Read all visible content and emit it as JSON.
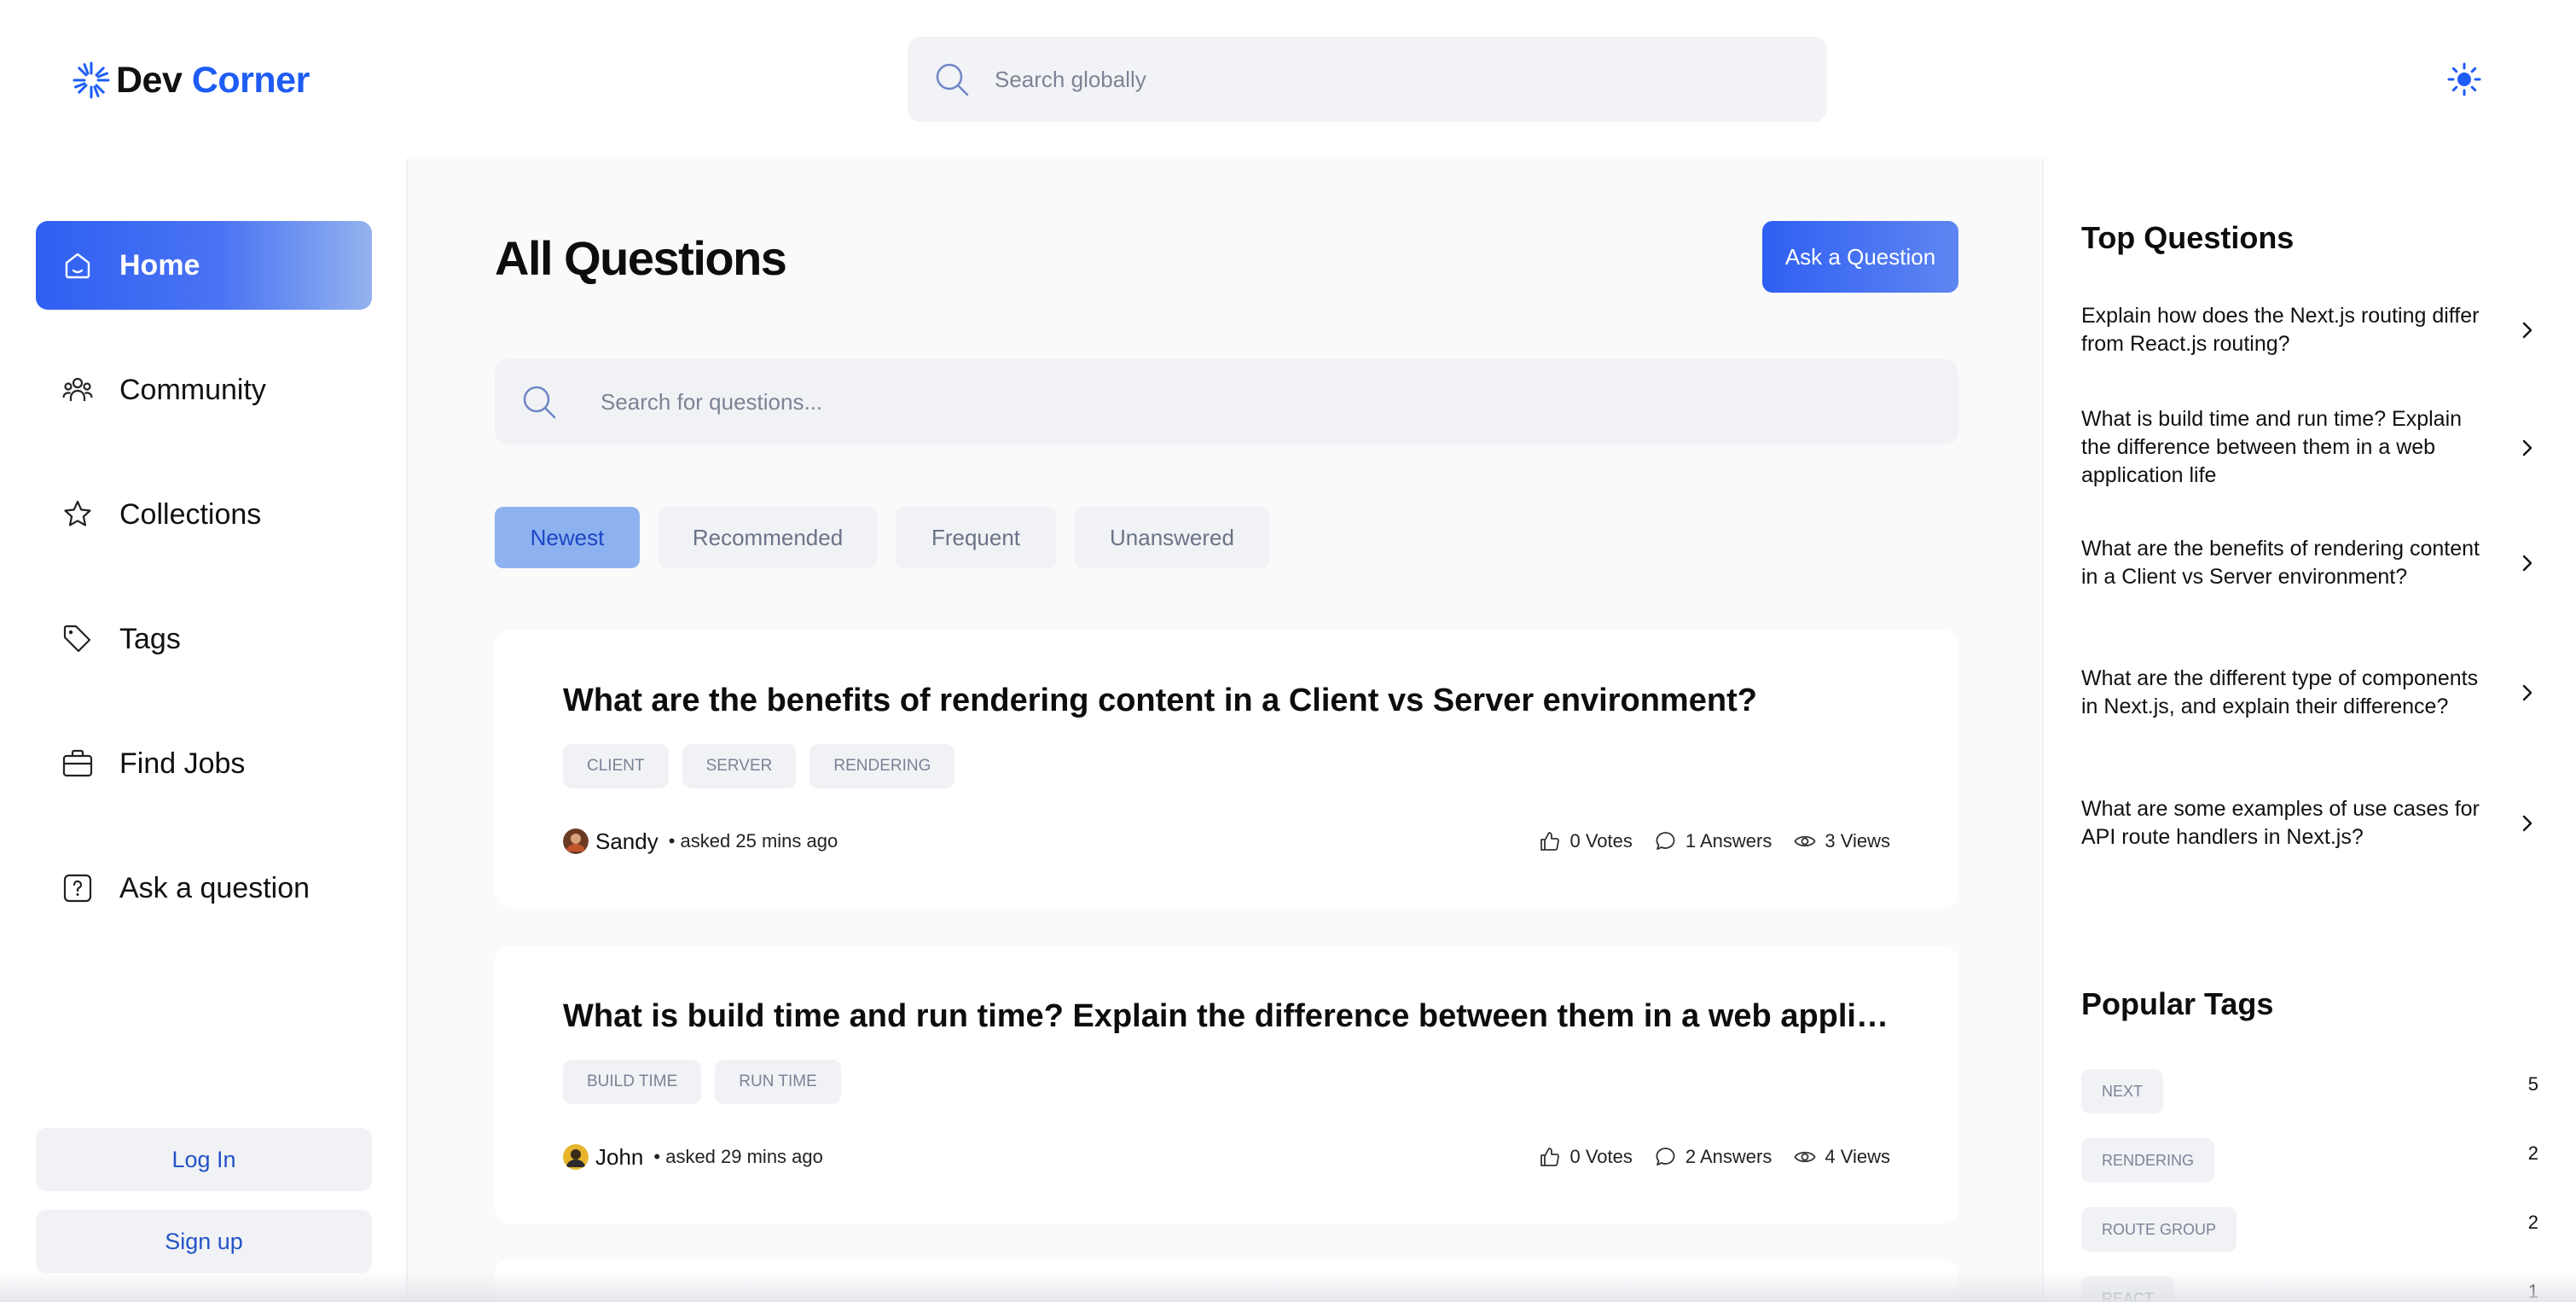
{
  "header": {
    "logo_part1": "Dev",
    "logo_part2": "Corner",
    "search_placeholder": "Search globally",
    "theme_icon": "sun-icon"
  },
  "colors": {
    "brand": "#1d5cf5",
    "accent_gradient_start": "#2f5ff2",
    "accent_gradient_end": "#93b2ee",
    "active_filter_bg": "#8eb2f0",
    "surface": "#f1f2f5"
  },
  "sidebar": {
    "items": [
      {
        "label": "Home",
        "icon": "home-icon",
        "active": true
      },
      {
        "label": "Community",
        "icon": "users-icon",
        "active": false
      },
      {
        "label": "Collections",
        "icon": "star-icon",
        "active": false
      },
      {
        "label": "Tags",
        "icon": "tag-icon",
        "active": false
      },
      {
        "label": "Find Jobs",
        "icon": "briefcase-icon",
        "active": false
      },
      {
        "label": "Ask a question",
        "icon": "question-icon",
        "active": false
      }
    ],
    "login_label": "Log In",
    "signup_label": "Sign up"
  },
  "main": {
    "title": "All Questions",
    "ask_button_label": "Ask a Question",
    "search_placeholder": "Search for questions...",
    "filters": [
      {
        "label": "Newest",
        "active": true
      },
      {
        "label": "Recommended",
        "active": false
      },
      {
        "label": "Frequent",
        "active": false
      },
      {
        "label": "Unanswered",
        "active": false
      }
    ],
    "questions": [
      {
        "title": "What are the benefits of rendering content in a Client vs Server environment?",
        "tags": [
          "CLIENT",
          "SERVER",
          "RENDERING"
        ],
        "author": "Sandy",
        "asked": "• asked 25 mins ago",
        "votes": "0 Votes",
        "answers": "1 Answers",
        "views": "3 Views"
      },
      {
        "title": "What is build time and run time? Explain the difference between them in a web application life",
        "tags": [
          "BUILD TIME",
          "RUN TIME"
        ],
        "author": "John",
        "asked": "• asked 29 mins ago",
        "votes": "0 Votes",
        "answers": "2 Answers",
        "views": "4 Views"
      }
    ]
  },
  "right_sidebar": {
    "top_questions_title": "Top Questions",
    "top_questions": [
      "Explain how does the Next.js routing differ from React.js routing?",
      "What is build time and run time? Explain the difference between them in a web application life",
      "What are the benefits of rendering content in a Client vs Server environment?",
      "What are the different type of components in Next.js, and explain their difference?",
      "What are some examples of use cases for API route handlers in Next.js?"
    ],
    "popular_tags_title": "Popular Tags",
    "popular_tags": [
      {
        "name": "NEXT",
        "count": "5"
      },
      {
        "name": "RENDERING",
        "count": "2"
      },
      {
        "name": "ROUTE GROUP",
        "count": "2"
      },
      {
        "name": "REACT",
        "count": "1"
      }
    ]
  }
}
